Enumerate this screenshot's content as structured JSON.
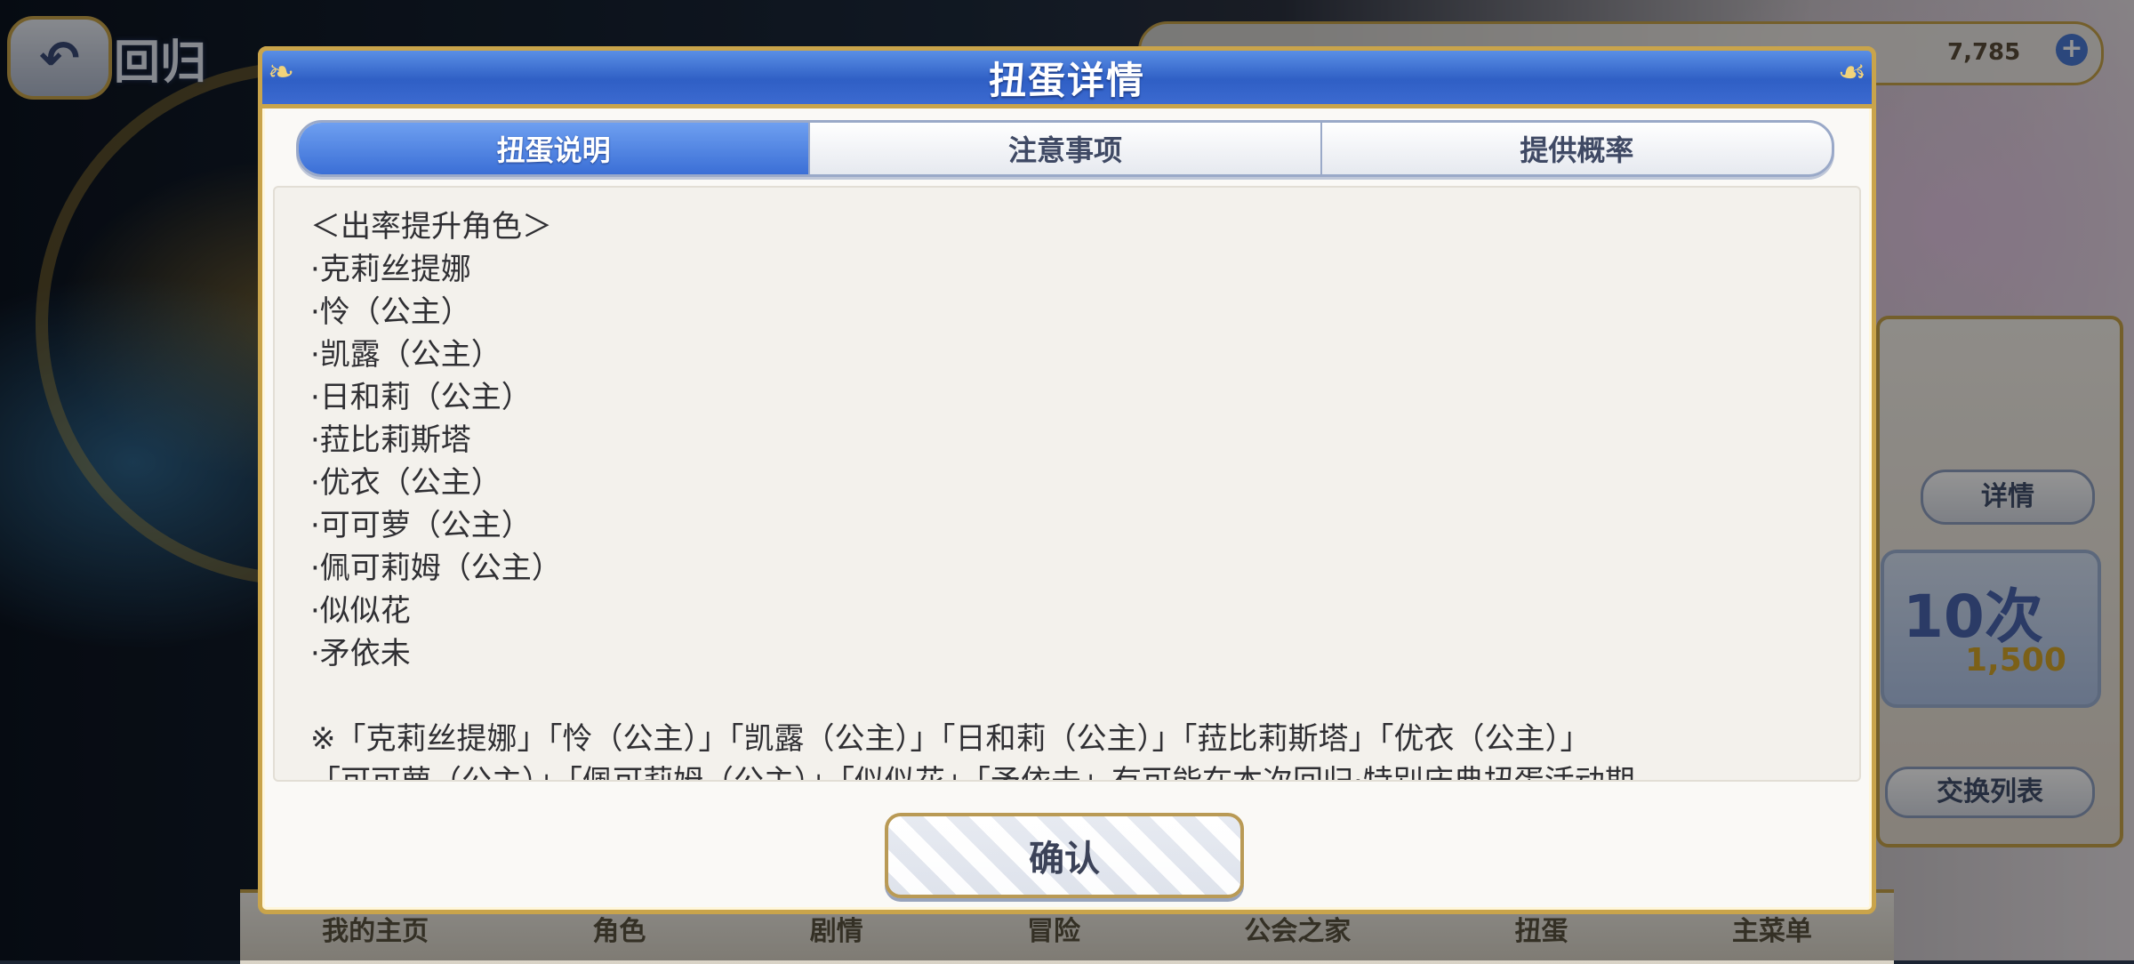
{
  "background": {
    "back_label": "回归",
    "gem_count": "7,785",
    "detail_button": "详情",
    "ten_pull_label": "10次",
    "ten_pull_cost": "1,500",
    "exchange_button": "交换列表",
    "nav_items": [
      "我的主页",
      "角色",
      "剧情",
      "冒险",
      "公会之家",
      "扭蛋",
      "主菜单"
    ]
  },
  "dialog": {
    "title": "扭蛋详情",
    "tabs": [
      {
        "label": "扭蛋说明",
        "active": true
      },
      {
        "label": "注意事项",
        "active": false
      },
      {
        "label": "提供概率",
        "active": false
      }
    ],
    "content": {
      "heading": "＜出率提升角色＞",
      "characters": [
        "·克莉丝提娜",
        "·怜（公主）",
        "·凯露（公主）",
        "·日和莉（公主）",
        "·菈比莉斯塔",
        "·优衣（公主）",
        "·可可萝（公主）",
        "·佩可莉姆（公主）",
        "·似似花",
        "·矛依未"
      ],
      "note_line1": "※「克莉丝提娜」「怜（公主）」「凯露（公主）」「日和莉（公主）」「菈比莉斯塔」「优衣（公主）」",
      "note_line2": "「可可萝（公主）」「佩可莉姆（公主）」「似似花」「矛依未」有可能在本次回归·特别庆典扭蛋活动期"
    },
    "confirm_label": "确认"
  },
  "colors": {
    "header_blue": "#3b6fd6",
    "gold_border": "#c9a44b",
    "panel_bg": "#faf9f6"
  }
}
